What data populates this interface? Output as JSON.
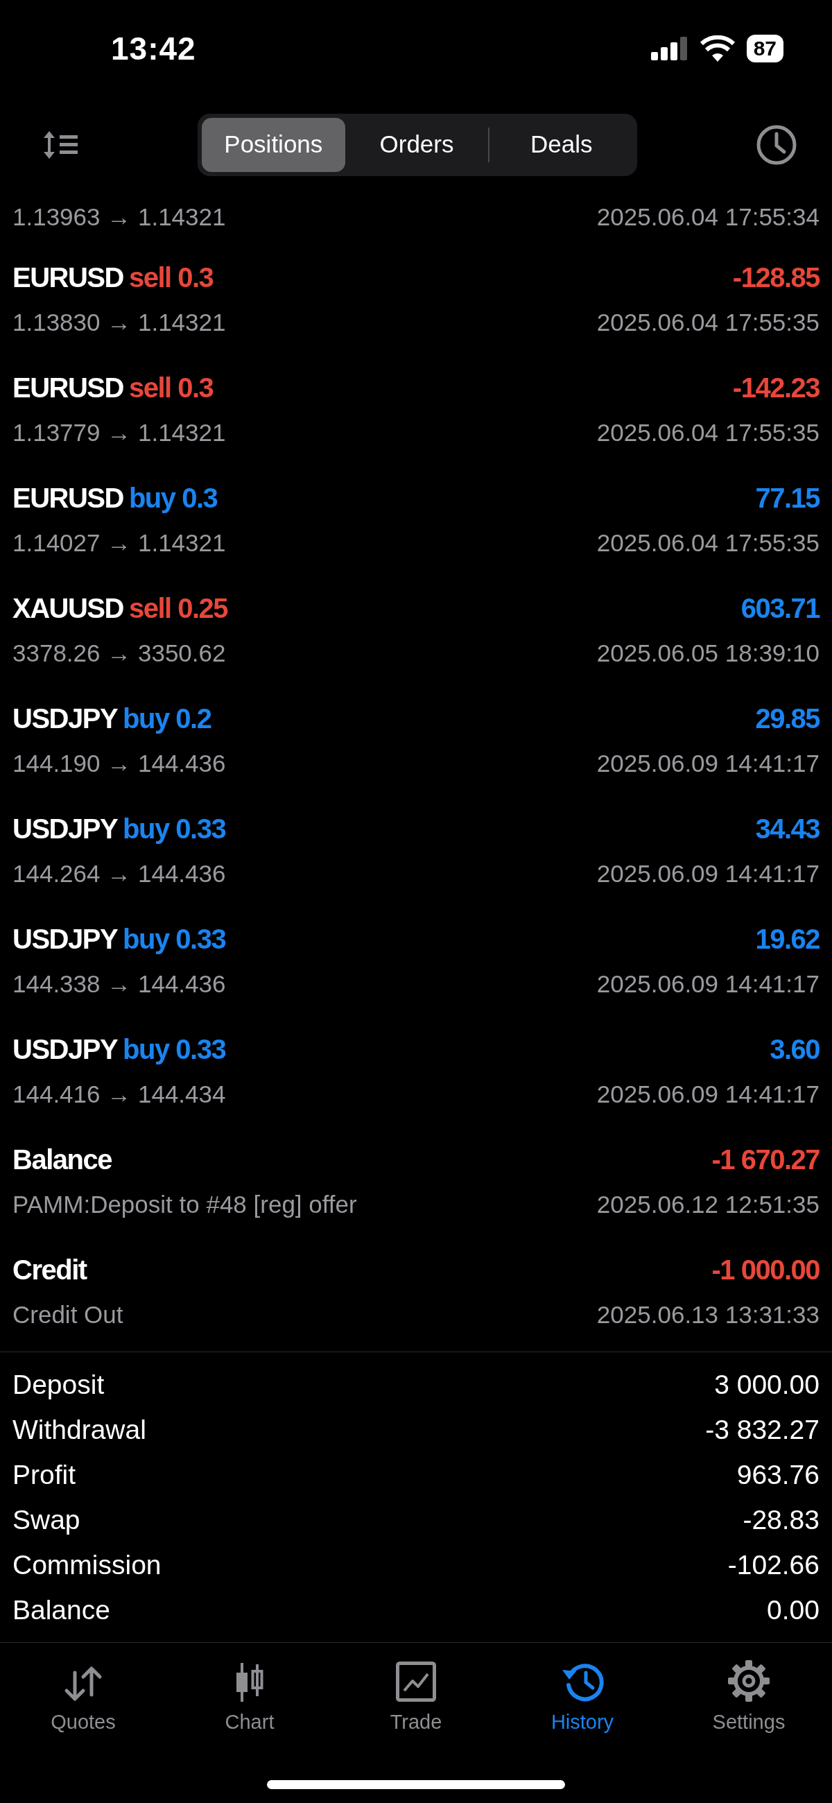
{
  "status_bar": {
    "time": "13:42",
    "battery": "87"
  },
  "tabs": [
    {
      "label": "Positions",
      "selected": true
    },
    {
      "label": "Orders",
      "selected": false
    },
    {
      "label": "Deals",
      "selected": false
    }
  ],
  "rows": [
    {
      "kind": "partial",
      "prices": "1.13963 → 1.14321",
      "time": "2025.06.04 17:55:34"
    },
    {
      "kind": "sell",
      "symbol": "EURUSD",
      "action": "sell 0.3",
      "result": "-128.85",
      "loss": true,
      "prices": "1.13830 → 1.14321",
      "time": "2025.06.04 17:55:35"
    },
    {
      "kind": "sell",
      "symbol": "EURUSD",
      "action": "sell 0.3",
      "result": "-142.23",
      "loss": true,
      "prices": "1.13779 → 1.14321",
      "time": "2025.06.04 17:55:35"
    },
    {
      "kind": "buy",
      "symbol": "EURUSD",
      "action": "buy 0.3",
      "result": "77.15",
      "loss": false,
      "prices": "1.14027 → 1.14321",
      "time": "2025.06.04 17:55:35"
    },
    {
      "kind": "sell",
      "symbol": "XAUUSD",
      "action": "sell 0.25",
      "result": "603.71",
      "loss": false,
      "prices": "3378.26 → 3350.62",
      "time": "2025.06.05 18:39:10"
    },
    {
      "kind": "buy",
      "symbol": "USDJPY",
      "action": "buy 0.2",
      "result": "29.85",
      "loss": false,
      "prices": "144.190 → 144.436",
      "time": "2025.06.09 14:41:17"
    },
    {
      "kind": "buy",
      "symbol": "USDJPY",
      "action": "buy 0.33",
      "result": "34.43",
      "loss": false,
      "prices": "144.264 → 144.436",
      "time": "2025.06.09 14:41:17"
    },
    {
      "kind": "buy",
      "symbol": "USDJPY",
      "action": "buy 0.33",
      "result": "19.62",
      "loss": false,
      "prices": "144.338 → 144.436",
      "time": "2025.06.09 14:41:17"
    },
    {
      "kind": "buy",
      "symbol": "USDJPY",
      "action": "buy 0.33",
      "result": "3.60",
      "loss": false,
      "prices": "144.416 → 144.434",
      "time": "2025.06.09 14:41:17"
    },
    {
      "kind": "balance",
      "symbol": "Balance",
      "result": "-1 670.27",
      "loss": true,
      "prices": "PAMM:Deposit to #48 [reg] offer",
      "time": "2025.06.12 12:51:35"
    },
    {
      "kind": "balance",
      "symbol": "Credit",
      "result": "-1 000.00",
      "loss": true,
      "prices": "Credit Out",
      "time": "2025.06.13 13:31:33"
    }
  ],
  "summary": [
    {
      "label": "Deposit",
      "value": "3 000.00"
    },
    {
      "label": "Withdrawal",
      "value": "-3 832.27"
    },
    {
      "label": "Profit",
      "value": "963.76"
    },
    {
      "label": "Swap",
      "value": "-28.83"
    },
    {
      "label": "Commission",
      "value": "-102.66"
    },
    {
      "label": "Balance",
      "value": "0.00"
    }
  ],
  "bottom_tabs": [
    {
      "label": "Quotes",
      "kind": "arrows",
      "selected": false
    },
    {
      "label": "Chart",
      "kind": "candles",
      "selected": false
    },
    {
      "label": "Trade",
      "kind": "trade",
      "selected": false
    },
    {
      "label": "History",
      "kind": "history",
      "selected": true
    },
    {
      "label": "Settings",
      "kind": "gear",
      "selected": false
    }
  ]
}
